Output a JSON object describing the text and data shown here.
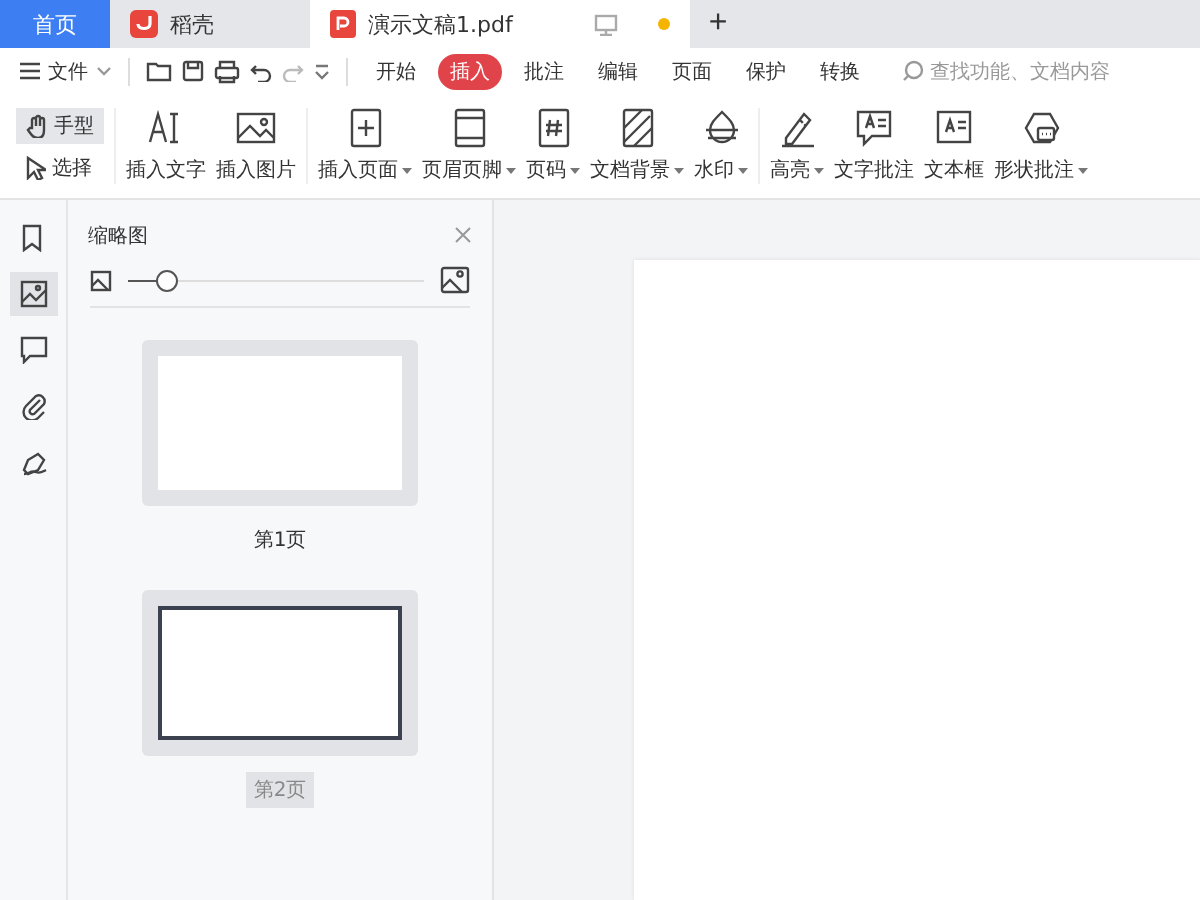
{
  "tabs": [
    {
      "label": "首页",
      "kind": "home",
      "selected": false
    },
    {
      "label": "稻壳",
      "kind": "app",
      "selected": false
    },
    {
      "label": "演示文稿1.pdf",
      "kind": "doc",
      "selected": true
    }
  ],
  "new_tab": "+",
  "menu": {
    "file": "文件",
    "ribbon_tabs": [
      {
        "label": "开始",
        "selected": false
      },
      {
        "label": "插入",
        "selected": true
      },
      {
        "label": "批注",
        "selected": false
      },
      {
        "label": "编辑",
        "selected": false
      },
      {
        "label": "页面",
        "selected": false
      },
      {
        "label": "保护",
        "selected": false
      },
      {
        "label": "转换",
        "selected": false
      }
    ],
    "search": {
      "placeholder": "查找功能、文档内容"
    }
  },
  "modes": [
    {
      "label": "手型",
      "selected": true
    },
    {
      "label": "选择",
      "selected": false
    }
  ],
  "ribbon_groups": [
    [
      {
        "label": "插入文字",
        "dropdown": false
      },
      {
        "label": "插入图片",
        "dropdown": false
      }
    ],
    [
      {
        "label": "插入页面",
        "dropdown": true
      },
      {
        "label": "页眉页脚",
        "dropdown": true
      },
      {
        "label": "页码",
        "dropdown": true
      },
      {
        "label": "文档背景",
        "dropdown": true
      },
      {
        "label": "水印",
        "dropdown": true
      }
    ],
    [
      {
        "label": "高亮",
        "dropdown": true
      },
      {
        "label": "文字批注",
        "dropdown": false
      },
      {
        "label": "文本框",
        "dropdown": false
      },
      {
        "label": "形状批注",
        "dropdown": true
      }
    ]
  ],
  "side_rail": [
    {
      "selected": false
    },
    {
      "selected": true
    },
    {
      "selected": false
    },
    {
      "selected": false
    },
    {
      "selected": false
    }
  ],
  "thumbnail_panel": {
    "title": "缩略图",
    "zoom": {
      "level": 0.13
    },
    "pages": [
      {
        "label": "第1页",
        "selected": false
      },
      {
        "label": "第2页",
        "selected": true
      }
    ]
  }
}
